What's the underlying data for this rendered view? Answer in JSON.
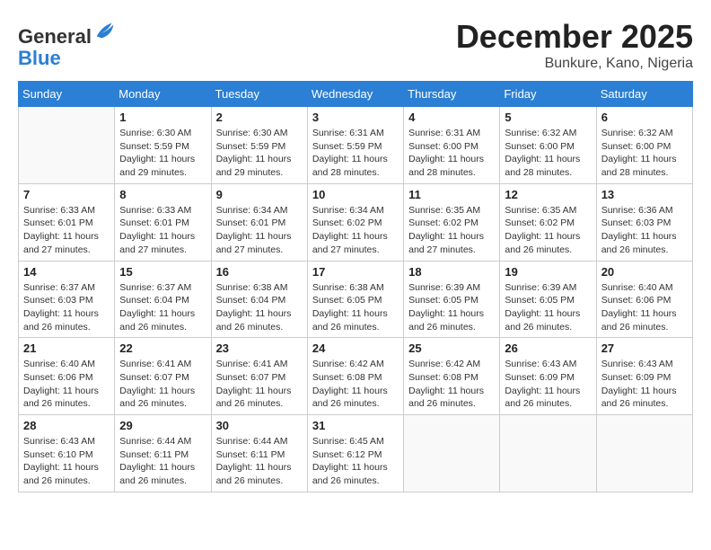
{
  "header": {
    "logo_general": "General",
    "logo_blue": "Blue",
    "month_year": "December 2025",
    "location": "Bunkure, Kano, Nigeria"
  },
  "weekdays": [
    "Sunday",
    "Monday",
    "Tuesday",
    "Wednesday",
    "Thursday",
    "Friday",
    "Saturday"
  ],
  "weeks": [
    [
      {
        "day": "",
        "sunrise": "",
        "sunset": "",
        "daylight": ""
      },
      {
        "day": "1",
        "sunrise": "Sunrise: 6:30 AM",
        "sunset": "Sunset: 5:59 PM",
        "daylight": "Daylight: 11 hours and 29 minutes."
      },
      {
        "day": "2",
        "sunrise": "Sunrise: 6:30 AM",
        "sunset": "Sunset: 5:59 PM",
        "daylight": "Daylight: 11 hours and 29 minutes."
      },
      {
        "day": "3",
        "sunrise": "Sunrise: 6:31 AM",
        "sunset": "Sunset: 5:59 PM",
        "daylight": "Daylight: 11 hours and 28 minutes."
      },
      {
        "day": "4",
        "sunrise": "Sunrise: 6:31 AM",
        "sunset": "Sunset: 6:00 PM",
        "daylight": "Daylight: 11 hours and 28 minutes."
      },
      {
        "day": "5",
        "sunrise": "Sunrise: 6:32 AM",
        "sunset": "Sunset: 6:00 PM",
        "daylight": "Daylight: 11 hours and 28 minutes."
      },
      {
        "day": "6",
        "sunrise": "Sunrise: 6:32 AM",
        "sunset": "Sunset: 6:00 PM",
        "daylight": "Daylight: 11 hours and 28 minutes."
      }
    ],
    [
      {
        "day": "7",
        "sunrise": "Sunrise: 6:33 AM",
        "sunset": "Sunset: 6:01 PM",
        "daylight": "Daylight: 11 hours and 27 minutes."
      },
      {
        "day": "8",
        "sunrise": "Sunrise: 6:33 AM",
        "sunset": "Sunset: 6:01 PM",
        "daylight": "Daylight: 11 hours and 27 minutes."
      },
      {
        "day": "9",
        "sunrise": "Sunrise: 6:34 AM",
        "sunset": "Sunset: 6:01 PM",
        "daylight": "Daylight: 11 hours and 27 minutes."
      },
      {
        "day": "10",
        "sunrise": "Sunrise: 6:34 AM",
        "sunset": "Sunset: 6:02 PM",
        "daylight": "Daylight: 11 hours and 27 minutes."
      },
      {
        "day": "11",
        "sunrise": "Sunrise: 6:35 AM",
        "sunset": "Sunset: 6:02 PM",
        "daylight": "Daylight: 11 hours and 27 minutes."
      },
      {
        "day": "12",
        "sunrise": "Sunrise: 6:35 AM",
        "sunset": "Sunset: 6:02 PM",
        "daylight": "Daylight: 11 hours and 26 minutes."
      },
      {
        "day": "13",
        "sunrise": "Sunrise: 6:36 AM",
        "sunset": "Sunset: 6:03 PM",
        "daylight": "Daylight: 11 hours and 26 minutes."
      }
    ],
    [
      {
        "day": "14",
        "sunrise": "Sunrise: 6:37 AM",
        "sunset": "Sunset: 6:03 PM",
        "daylight": "Daylight: 11 hours and 26 minutes."
      },
      {
        "day": "15",
        "sunrise": "Sunrise: 6:37 AM",
        "sunset": "Sunset: 6:04 PM",
        "daylight": "Daylight: 11 hours and 26 minutes."
      },
      {
        "day": "16",
        "sunrise": "Sunrise: 6:38 AM",
        "sunset": "Sunset: 6:04 PM",
        "daylight": "Daylight: 11 hours and 26 minutes."
      },
      {
        "day": "17",
        "sunrise": "Sunrise: 6:38 AM",
        "sunset": "Sunset: 6:05 PM",
        "daylight": "Daylight: 11 hours and 26 minutes."
      },
      {
        "day": "18",
        "sunrise": "Sunrise: 6:39 AM",
        "sunset": "Sunset: 6:05 PM",
        "daylight": "Daylight: 11 hours and 26 minutes."
      },
      {
        "day": "19",
        "sunrise": "Sunrise: 6:39 AM",
        "sunset": "Sunset: 6:05 PM",
        "daylight": "Daylight: 11 hours and 26 minutes."
      },
      {
        "day": "20",
        "sunrise": "Sunrise: 6:40 AM",
        "sunset": "Sunset: 6:06 PM",
        "daylight": "Daylight: 11 hours and 26 minutes."
      }
    ],
    [
      {
        "day": "21",
        "sunrise": "Sunrise: 6:40 AM",
        "sunset": "Sunset: 6:06 PM",
        "daylight": "Daylight: 11 hours and 26 minutes."
      },
      {
        "day": "22",
        "sunrise": "Sunrise: 6:41 AM",
        "sunset": "Sunset: 6:07 PM",
        "daylight": "Daylight: 11 hours and 26 minutes."
      },
      {
        "day": "23",
        "sunrise": "Sunrise: 6:41 AM",
        "sunset": "Sunset: 6:07 PM",
        "daylight": "Daylight: 11 hours and 26 minutes."
      },
      {
        "day": "24",
        "sunrise": "Sunrise: 6:42 AM",
        "sunset": "Sunset: 6:08 PM",
        "daylight": "Daylight: 11 hours and 26 minutes."
      },
      {
        "day": "25",
        "sunrise": "Sunrise: 6:42 AM",
        "sunset": "Sunset: 6:08 PM",
        "daylight": "Daylight: 11 hours and 26 minutes."
      },
      {
        "day": "26",
        "sunrise": "Sunrise: 6:43 AM",
        "sunset": "Sunset: 6:09 PM",
        "daylight": "Daylight: 11 hours and 26 minutes."
      },
      {
        "day": "27",
        "sunrise": "Sunrise: 6:43 AM",
        "sunset": "Sunset: 6:09 PM",
        "daylight": "Daylight: 11 hours and 26 minutes."
      }
    ],
    [
      {
        "day": "28",
        "sunrise": "Sunrise: 6:43 AM",
        "sunset": "Sunset: 6:10 PM",
        "daylight": "Daylight: 11 hours and 26 minutes."
      },
      {
        "day": "29",
        "sunrise": "Sunrise: 6:44 AM",
        "sunset": "Sunset: 6:11 PM",
        "daylight": "Daylight: 11 hours and 26 minutes."
      },
      {
        "day": "30",
        "sunrise": "Sunrise: 6:44 AM",
        "sunset": "Sunset: 6:11 PM",
        "daylight": "Daylight: 11 hours and 26 minutes."
      },
      {
        "day": "31",
        "sunrise": "Sunrise: 6:45 AM",
        "sunset": "Sunset: 6:12 PM",
        "daylight": "Daylight: 11 hours and 26 minutes."
      },
      {
        "day": "",
        "sunrise": "",
        "sunset": "",
        "daylight": ""
      },
      {
        "day": "",
        "sunrise": "",
        "sunset": "",
        "daylight": ""
      },
      {
        "day": "",
        "sunrise": "",
        "sunset": "",
        "daylight": ""
      }
    ]
  ]
}
